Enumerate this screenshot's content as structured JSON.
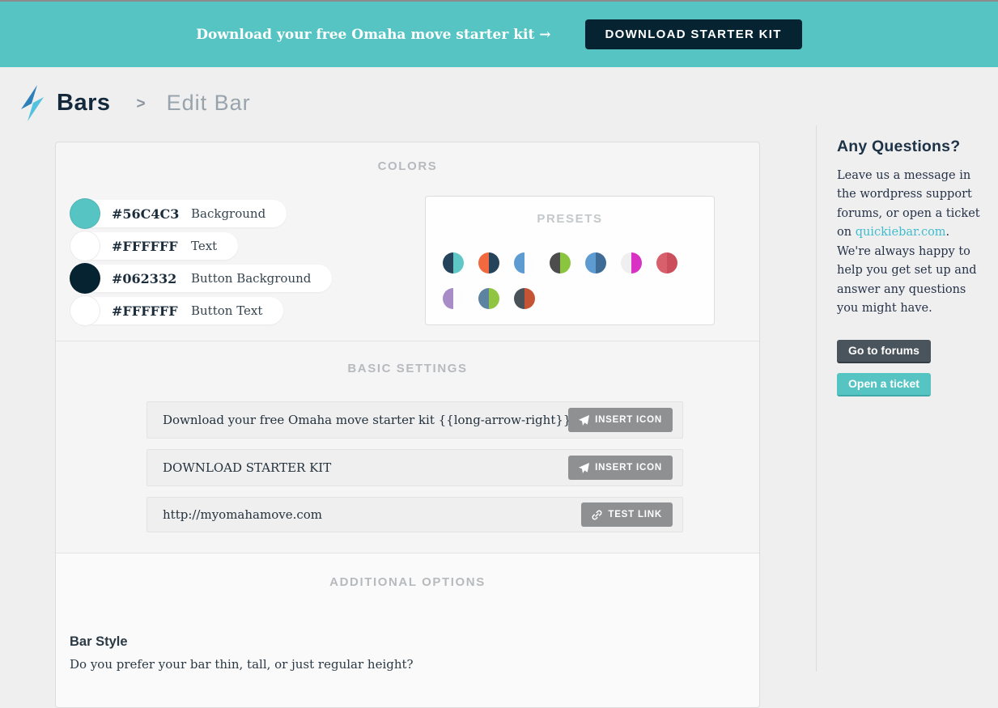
{
  "preview_bar": {
    "message": "Download your free Omaha move starter kit →",
    "button_label": "DOWNLOAD STARTER KIT",
    "background": "#56C4C3",
    "button_background": "#062332"
  },
  "breadcrumb": {
    "app": "Bars",
    "separator": ">",
    "current": "Edit Bar"
  },
  "colors_section": {
    "title": "COLORS",
    "swatches": [
      {
        "hex": "#56C4C3",
        "label": "Background",
        "color": "#56C4C3"
      },
      {
        "hex": "#FFFFFF",
        "label": "Text",
        "color": "#FFFFFF"
      },
      {
        "hex": "#062332",
        "label": "Button Background",
        "color": "#062332"
      },
      {
        "hex": "#FFFFFF",
        "label": "Button Text",
        "color": "#FFFFFF"
      }
    ],
    "presets": {
      "title": "PRESETS",
      "swatches": [
        {
          "left": "#25435A",
          "right": "#5FC8C6"
        },
        {
          "left": "#F2683F",
          "right": "#25435A"
        },
        {
          "left": "#5E9BD1",
          "right": "#FDFDFD"
        },
        {
          "left": "#4D4D4D",
          "right": "#8BC53F"
        },
        {
          "left": "#5E9BD1",
          "right": "#3E6C96"
        },
        {
          "left": "#EFEFEF",
          "right": "#D831C3"
        },
        {
          "left": "#D8606D",
          "right": "#CB4E5D"
        },
        {
          "left": "#A78CC8",
          "right": "#FDFDFD"
        },
        {
          "left": "#5C84A0",
          "right": "#8FC541"
        },
        {
          "left": "#495259",
          "right": "#C55434"
        }
      ]
    }
  },
  "basic_settings": {
    "title": "BASIC SETTINGS",
    "bar_text": {
      "value": "Download your free Omaha move starter kit {{long-arrow-right}}",
      "button_label": "INSERT ICON"
    },
    "button_text": {
      "value": "DOWNLOAD STARTER KIT",
      "button_label": "INSERT ICON"
    },
    "link_url": {
      "value": "http://myomahamove.com",
      "button_label": "TEST LINK"
    }
  },
  "additional_options": {
    "title": "ADDITIONAL OPTIONS",
    "bar_style_heading": "Bar Style",
    "bar_style_description": "Do you prefer your bar thin, tall, or just regular height?"
  },
  "sidebar": {
    "heading": "Any Questions?",
    "text_before_link": "Leave us a message in the wordpress support forums, or open a ticket on ",
    "link_label": "quickiebar.com",
    "text_after_link": ". We're always happy to help you get set up and answer any questions you might have.",
    "link_color": "#3FBDCF",
    "forums_button_label": "Go to forums",
    "forums_button_color": "#4A545C",
    "ticket_button_label": "Open a ticket",
    "ticket_button_color": "#56C4C3"
  }
}
